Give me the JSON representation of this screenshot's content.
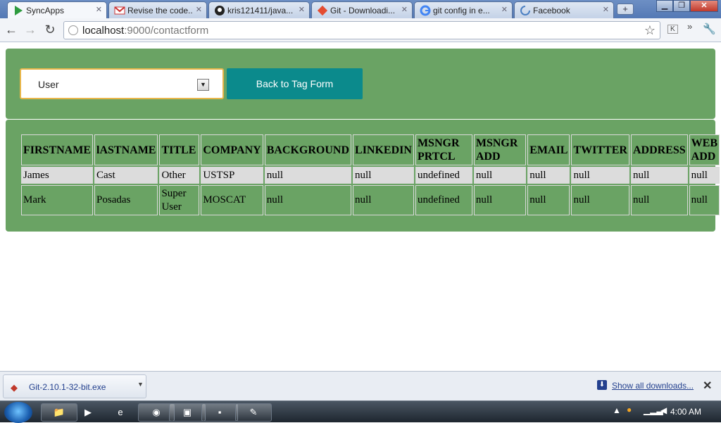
{
  "browser": {
    "tabs": [
      {
        "title": "SyncApps",
        "active": true,
        "icon": "play-icon"
      },
      {
        "title": "Revise the code...",
        "active": false,
        "icon": "gmail-icon"
      },
      {
        "title": "kris121411/java...",
        "active": false,
        "icon": "github-icon"
      },
      {
        "title": "Git - Downloadi...",
        "active": false,
        "icon": "git-icon"
      },
      {
        "title": "git config in e...",
        "active": false,
        "icon": "google-icon"
      },
      {
        "title": "Facebook",
        "active": false,
        "icon": "loading-icon"
      }
    ],
    "new_tab_symbol": "+",
    "address": {
      "host": "localhost",
      "rest": ":9000/contactform"
    }
  },
  "form": {
    "select_value": "User",
    "back_button": "Back to Tag Form"
  },
  "table": {
    "headers": [
      "FIRSTNAME",
      "lASTNAME",
      "TITLE",
      "COMPANY",
      "BACKGROUND",
      "LINKEDIN",
      "MSNGR PRTCL",
      "MSNGR ADD",
      "EMAIL",
      "TWITTER",
      "ADDRESS",
      "WEB ADD"
    ],
    "rows": [
      [
        "James",
        "Cast",
        "Other",
        "USTSP",
        "null",
        "null",
        "undefined",
        "null",
        "null",
        "null",
        "null",
        "null"
      ],
      [
        "Mark",
        "Posadas",
        "Super User",
        "MOSCAT",
        "null",
        "null",
        "undefined",
        "null",
        "null",
        "null",
        "null",
        "null"
      ]
    ]
  },
  "downloads": {
    "file_name": "Git-2.10.1-32-bit.exe",
    "show_all": "Show all downloads...",
    "close": "✕"
  },
  "taskbar": {
    "clock": "4:00 AM"
  },
  "colors": {
    "panel": "#6aa364",
    "button": "#0b8a8c",
    "select_border": "#e8b64a"
  }
}
